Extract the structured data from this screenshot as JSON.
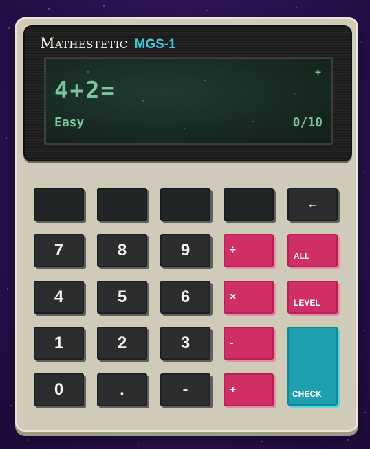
{
  "brand": {
    "name": "Mathestetic",
    "model": "MGS-1"
  },
  "display": {
    "expression": "4+2=",
    "operator_indicator": "+",
    "level": "Easy",
    "score": "0/10"
  },
  "keys": {
    "backspace": "←",
    "all": "ALL",
    "level": "LEVEL",
    "check": "CHECK",
    "divide": "÷",
    "multiply": "×",
    "minus": "-",
    "plus": "+",
    "seven": "7",
    "eight": "8",
    "nine": "9",
    "four": "4",
    "five": "5",
    "six": "6",
    "one": "1",
    "two": "2",
    "three": "3",
    "zero": "0",
    "decimal": ".",
    "negate": "-"
  },
  "colors": {
    "accent_pink": "#cf2f64",
    "accent_teal": "#1d9fad",
    "display_text": "#7cc49c",
    "body": "#cfcbb8"
  }
}
